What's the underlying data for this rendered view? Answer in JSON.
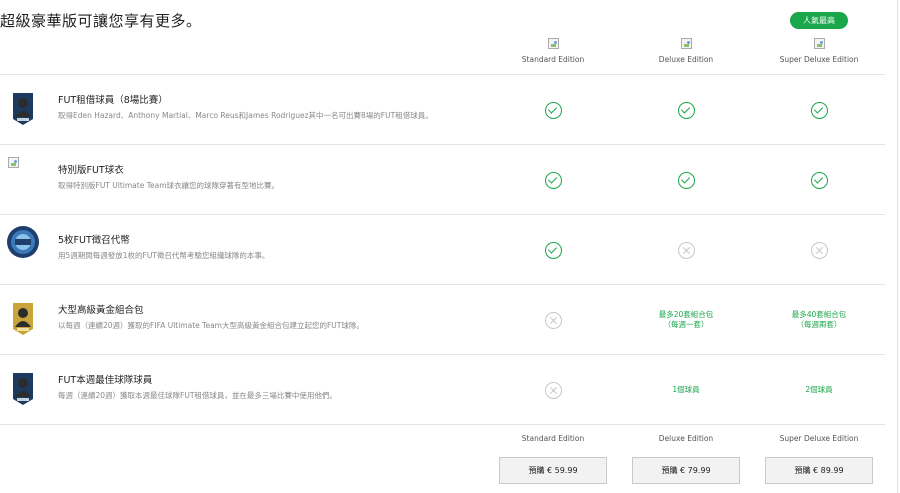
{
  "header": {
    "title": "超級豪華版可讓您享有更多。",
    "badge": "人氣最高"
  },
  "editions": [
    "Standard Edition",
    "Deluxe Edition",
    "Super Deluxe Edition"
  ],
  "rows": [
    {
      "icon": "player-card-icon",
      "title": "FUT租借球員（8場比賽）",
      "desc": "取得Eden Hazard、Anthony Martial、Marco Reus和James Rodriguez其中一名可出賽8場的FUT租借球員。",
      "cells": [
        {
          "type": "check"
        },
        {
          "type": "check"
        },
        {
          "type": "check"
        }
      ]
    },
    {
      "icon": "broken-image-icon",
      "title": "特別版FUT球衣",
      "desc": "取得特別版FUT Ultimate Team球衣讓您的球隊穿著有型地比賽。",
      "cells": [
        {
          "type": "check"
        },
        {
          "type": "check"
        },
        {
          "type": "check"
        }
      ]
    },
    {
      "icon": "draft-token-icon",
      "title": "5枚FUT徵召代幣",
      "desc": "用5週期間每週發放1枚的FUT徵召代幣考驗您組織球隊的本事。",
      "cells": [
        {
          "type": "check"
        },
        {
          "type": "cross"
        },
        {
          "type": "cross"
        }
      ]
    },
    {
      "icon": "gold-pack-icon",
      "title": "大型高級黃金組合包",
      "desc": "以每週（連續20週）獲取的FIFA Ultimate Team大型高級黃金組合包建立起您的FUT球隊。",
      "cells": [
        {
          "type": "cross"
        },
        {
          "type": "text",
          "text": "最多20套組合包\n（每週一套）"
        },
        {
          "type": "text",
          "text": "最多40套組合包\n（每週兩套）"
        }
      ]
    },
    {
      "icon": "totw-player-icon",
      "title": "FUT本週最佳球隊球員",
      "desc": "每週（連續20週）獲取本週最佳球隊FUT租借球員，並在最多三場比賽中使用他們。",
      "cells": [
        {
          "type": "cross"
        },
        {
          "type": "text",
          "text": "1個球員"
        },
        {
          "type": "text",
          "text": "2個球員"
        }
      ]
    }
  ],
  "footer": {
    "buttons": [
      "預購 € 59.99",
      "預購 € 79.99",
      "預購 € 89.99"
    ]
  },
  "colors": {
    "accent": "#1aa64b",
    "muted": "#c7c7c7"
  }
}
